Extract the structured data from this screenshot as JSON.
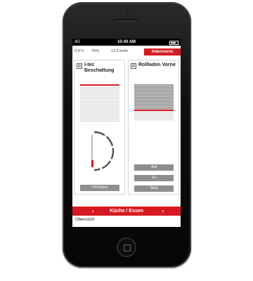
{
  "status": {
    "signal": "4G",
    "time": "10:40 AM"
  },
  "weather": {
    "temp": "0.4°C",
    "humidity": "75%",
    "wind": "13.5 km/h"
  },
  "brand": "Internorm",
  "cards": [
    {
      "title": "I-tec Beschattung",
      "button": "I-Position"
    },
    {
      "title": "Rollladen Vorne",
      "buttons": [
        "Auf",
        "Zu",
        "Stop"
      ]
    }
  ],
  "nav": {
    "room": "Küche / Essen",
    "prev": "‹",
    "next": "›"
  },
  "footer": {
    "label": "Übersicht"
  },
  "colors": {
    "accent": "#d71920",
    "button": "#8e8e8e"
  },
  "icons": [
    "shade-card-icon",
    "shutter-card-icon",
    "temperature-icon",
    "humidity-icon",
    "wind-icon"
  ]
}
